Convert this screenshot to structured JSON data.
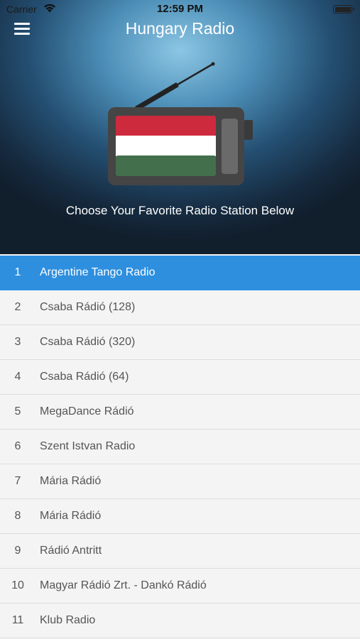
{
  "status_bar": {
    "carrier": "Carrier",
    "time": "12:59 PM"
  },
  "header": {
    "title": "Hungary Radio",
    "subtitle": "Choose Your Favorite Radio Station Below"
  },
  "colors": {
    "flag_red": "#cd2a3e",
    "flag_white": "#ffffff",
    "flag_green": "#436f4d",
    "selected_row": "#2e8fde"
  },
  "stations": [
    {
      "num": "1",
      "name": "Argentine Tango Radio",
      "selected": true
    },
    {
      "num": "2",
      "name": "Csaba Rádió (128)"
    },
    {
      "num": "3",
      "name": "Csaba Rádió (320)"
    },
    {
      "num": "4",
      "name": "Csaba Rádió (64)"
    },
    {
      "num": "5",
      "name": "MegaDance Rádió"
    },
    {
      "num": "6",
      "name": "Szent Istvan Radio"
    },
    {
      "num": "7",
      "name": "Mária Rádió"
    },
    {
      "num": "8",
      "name": "Mária Rádió"
    },
    {
      "num": "9",
      "name": "Rádió Antritt"
    },
    {
      "num": "10",
      "name": "Magyar Rádió Zrt. - Dankó Rádió"
    },
    {
      "num": "11",
      "name": "Klub Radio"
    }
  ]
}
